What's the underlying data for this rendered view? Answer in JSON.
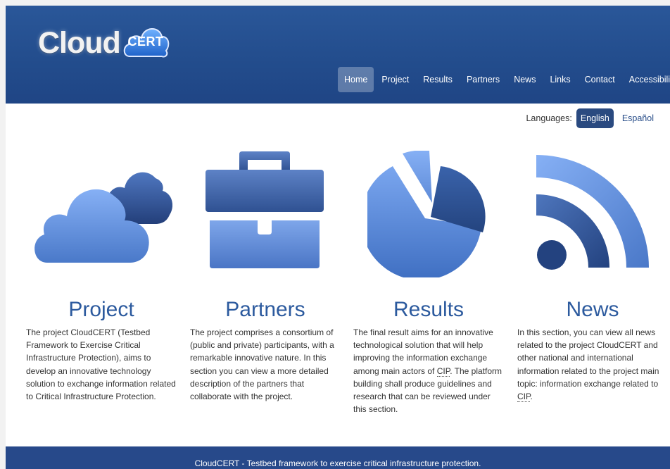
{
  "logo": {
    "word": "Cloud",
    "badge": "CERT"
  },
  "nav": {
    "items": [
      {
        "label": "Home",
        "active": true
      },
      {
        "label": "Project"
      },
      {
        "label": "Results"
      },
      {
        "label": "Partners"
      },
      {
        "label": "News"
      },
      {
        "label": "Links"
      },
      {
        "label": "Contact"
      },
      {
        "label": "Accessibility"
      }
    ]
  },
  "languages": {
    "label": "Languages:",
    "english": "English",
    "spanish": "Español"
  },
  "sections": {
    "project": {
      "icon": "cloud-icon",
      "title": "Project",
      "text": "The project CloudCERT (Testbed Framework to Exercise Critical Infrastructure Protection), aims to develop an innovative technology solution to exchange information related to Critical Infrastructure Protection."
    },
    "partners": {
      "icon": "briefcase-icon",
      "title": "Partners",
      "text": "The project comprises a consortium of (public and private) participants, with a remarkable innovative nature. In this section you can view a more detailed description of the partners that collaborate with the project."
    },
    "results": {
      "icon": "pie-chart-icon",
      "title": "Results",
      "text_before": "The final result aims for an innovative technological solution that will help improving the information exchange among main actors of ",
      "abbr": "CIP",
      "text_after": ". The platform building shall produce guidelines and research that can be reviewed under this section."
    },
    "news": {
      "icon": "rss-icon",
      "title": "News",
      "text_before": "In this section, you can view all news related to the project CloudCERT and other national and international information related to the project main topic: information exchange related to ",
      "abbr": "CIP",
      "text_after": "."
    }
  },
  "footer": {
    "text": "CloudCERT - Testbed framework to exercise critical infrastructure protection."
  },
  "colors": {
    "header": "#234d8d",
    "accent": "#2c5a9e",
    "icon_light": "#7fa8f0",
    "icon_dark": "#2d4f8e"
  }
}
